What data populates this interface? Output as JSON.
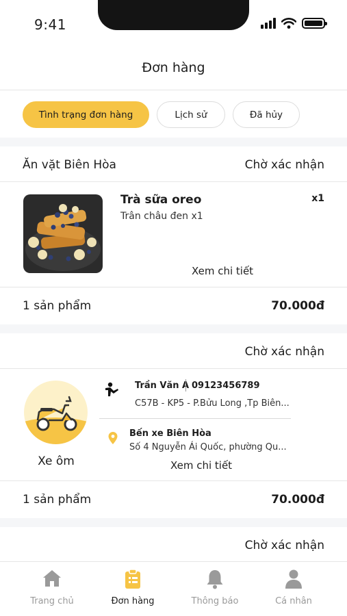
{
  "status_bar": {
    "time": "9:41"
  },
  "header": {
    "title": "Đơn hàng"
  },
  "tabs": [
    {
      "label": "Tình trạng đơn hàng",
      "active": true
    },
    {
      "label": "Lịch sử",
      "active": false
    },
    {
      "label": "Đã hủy",
      "active": false
    }
  ],
  "orders": [
    {
      "shop": "Ăn vặt Biên Hòa",
      "status": "Chờ xác nhận",
      "item": {
        "name": "Trà sữa oreo",
        "option": "Trân châu đen x1",
        "qty": "x1",
        "image_icon": "french-toast-photo"
      },
      "detail_label": "Xem chi tiết",
      "count": "1 sản phẩm",
      "total": "70.000đ"
    },
    {
      "shop": "",
      "status": "Chờ xác nhận",
      "service": "Xe ôm",
      "service_icon": "scooter-icon",
      "driver": {
        "name": "Trần Văn A",
        "phone": "09123456789",
        "pickup": "C57B - KP5 - P.Bửu Long ,Tp Biên..."
      },
      "destination": {
        "name": "Bến xe Biên Hòa",
        "address": "Số 4 Nguyễn Ái Quốc, phường Qu..."
      },
      "detail_label": "Xem chi tiết",
      "count": "1 sản phẩm",
      "total": "70.000đ"
    },
    {
      "shop": "",
      "status": "Chờ xác nhận"
    }
  ],
  "bottom_nav": [
    {
      "label": "Trang chủ",
      "icon": "home-icon",
      "active": false
    },
    {
      "label": "Đơn hàng",
      "icon": "clipboard-icon",
      "active": true
    },
    {
      "label": "Thông báo",
      "icon": "bell-icon",
      "active": false
    },
    {
      "label": "Cá nhân",
      "icon": "user-icon",
      "active": false
    }
  ],
  "colors": {
    "accent": "#f6c445",
    "inactive": "#9a9a9a",
    "divider": "#e6e6e6",
    "band": "#f5f6f8"
  }
}
